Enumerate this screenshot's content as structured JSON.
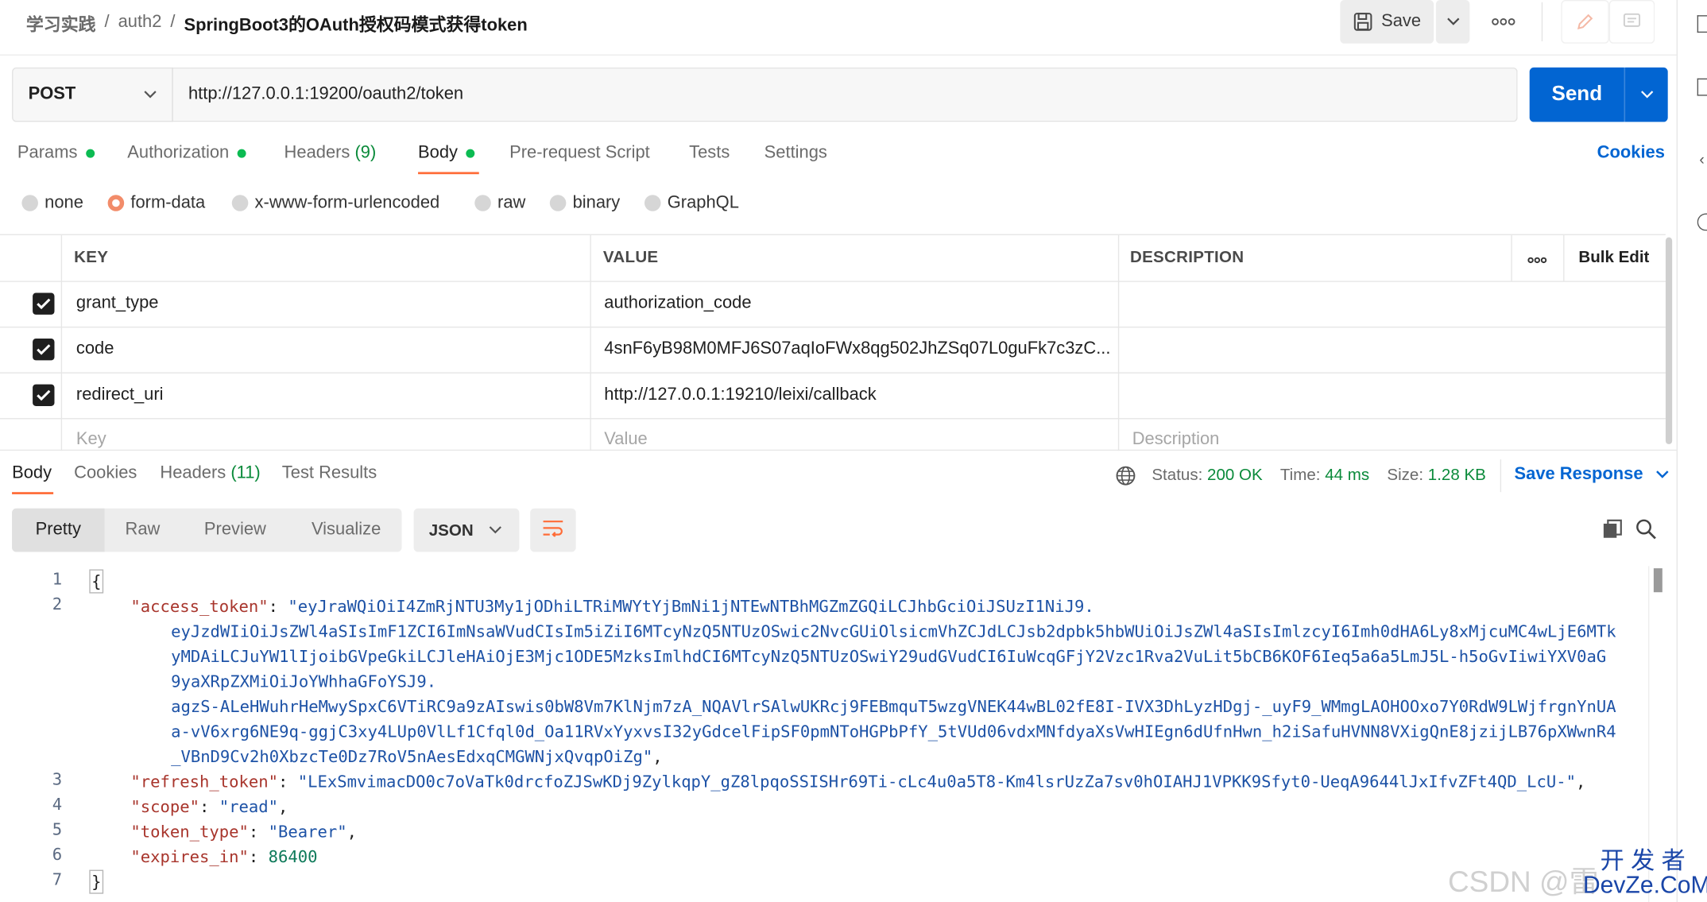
{
  "breadcrumb": {
    "items": [
      "学习实践",
      "auth2"
    ],
    "current": "SpringBoot3的OAuth授权码模式获得token",
    "separator": "/"
  },
  "toolbar": {
    "save_label": "Save"
  },
  "request": {
    "method": "POST",
    "url": "http://127.0.0.1:19200/oauth2/token",
    "send_label": "Send"
  },
  "req_tabs": {
    "params": "Params",
    "authorization": "Authorization",
    "headers": "Headers",
    "headers_count": "(9)",
    "body": "Body",
    "prerequest": "Pre-request Script",
    "tests": "Tests",
    "settings": "Settings",
    "cookies": "Cookies"
  },
  "body_types": {
    "none": "none",
    "form_data": "form-data",
    "urlencoded": "x-www-form-urlencoded",
    "raw": "raw",
    "binary": "binary",
    "graphql": "GraphQL",
    "selected": "form-data"
  },
  "form_table": {
    "headers": {
      "key": "KEY",
      "value": "VALUE",
      "description": "DESCRIPTION",
      "bulk_edit": "Bulk Edit"
    },
    "rows": [
      {
        "key": "grant_type",
        "value": "authorization_code",
        "checked": true
      },
      {
        "key": "code",
        "value": "4snF6yB98M0MFJ6S07aqIoFWx8qg502JhZSq07L0guFk7c3zC...",
        "checked": true
      },
      {
        "key": "redirect_uri",
        "value": "http://127.0.0.1:19210/leixi/callback",
        "checked": true
      }
    ],
    "placeholders": {
      "key": "Key",
      "value": "Value",
      "description": "Description"
    }
  },
  "response": {
    "tabs": {
      "body": "Body",
      "cookies": "Cookies",
      "headers": "Headers",
      "headers_count": "(11)",
      "test_results": "Test Results"
    },
    "status_label": "Status:",
    "status_value": "200 OK",
    "time_label": "Time:",
    "time_value": "44 ms",
    "size_label": "Size:",
    "size_value": "1.28 KB",
    "save_response": "Save Response",
    "view_modes": [
      "Pretty",
      "Raw",
      "Preview",
      "Visualize"
    ],
    "format": "JSON",
    "code": {
      "line_numbers": [
        "1",
        "2",
        "3",
        "4",
        "5",
        "6",
        "7"
      ],
      "open_brace": "{",
      "close_brace": "}",
      "access_token_key": "\"access_token\"",
      "access_token_lines": [
        "\"eyJraWQiOiI4ZmRjNTU3My1jODhiLTRiMWYtYjBmNi1jNTEwNTBhMGZmZGQiLCJhbGciOiJSUzI1NiJ9.",
        "eyJzdWIiOiJsZWl4aSIsImF1ZCI6ImNsaWVudCIsIm5iZiI6MTcyNzQ5NTUzOSwic2NvcGUiOlsicmVhZCJdLCJsb2dpbk5hbWUiOiJsZWl4aSIsImlzcyI6Imh0dHA6Ly8xMjcuMC4wLjE6MTk",
        "yMDAiLCJuYW1lIjoibGVpeGkiLCJleHAiOjE3Mjc1ODE5MzksImlhdCI6MTcyNzQ5NTUzOSwiY29udGVudCI6IuWcqGFjY2Vzc1Rva2VuLit5bCB6KOF6Ieq5a6a5LmJ5L-h5oGvIiwiYXV0aG",
        "9yaXRpZXMiOiJoYWhhaGFoYSJ9.",
        "agzS-ALeHWuhrHeMwySpxC6VTiRC9a9zAIswis0bW8Vm7KlNjm7zA_NQAVlrSAlwUKRcj9FEBmquT5wzgVNEK44wBL02fE8I-IVX3DhLyzHDgj-_uyF9_WMmgLAOHOOxo7Y0RdW9LWjfrgnYnUA",
        "a-vV6xrg6NE9q-ggjC3xy4LUp0VlLf1Cfql0d_Oa11RVxYyxvsI32yGdcelFipSF0pmNToHGPbPfY_5tVUd06vdxMNfdyaXsVwHIEgn6dUfnHwn_h2iSafuHVNN8VXigQnE8jzijLB76pXWwnR4",
        "_VBnD9Cv2h0XbzcTe0Dz7RoV5nAesEdxqCMGWNjxQvqpOiZg\""
      ],
      "refresh_token_key": "\"refresh_token\"",
      "refresh_token_value": "\"LExSmvimacDO0c7oVaTk0drcfoZJSwKDj9ZylkqpY_gZ8lpqoSSISHr69Ti-cLc4u0a5T8-Km4lsrUzZa7sv0hOIAHJ1VPKK9Sfyt0-UeqA9644lJxIfvZFt4QD_LcU-\"",
      "scope_key": "\"scope\"",
      "scope_value": "\"read\"",
      "token_type_key": "\"token_type\"",
      "token_type_value": "\"Bearer\"",
      "expires_in_key": "\"expires_in\"",
      "expires_in_value": "86400"
    }
  },
  "watermark": "CSDN @雷",
  "watermark_logo": "开 发 者 DevZe.CoM",
  "colors": {
    "send": "#0265d2",
    "accent_orange": "#ff6c37",
    "status_green": "#0a8a3a",
    "dot_green": "#0cbb52",
    "link_blue": "#0265d2"
  }
}
